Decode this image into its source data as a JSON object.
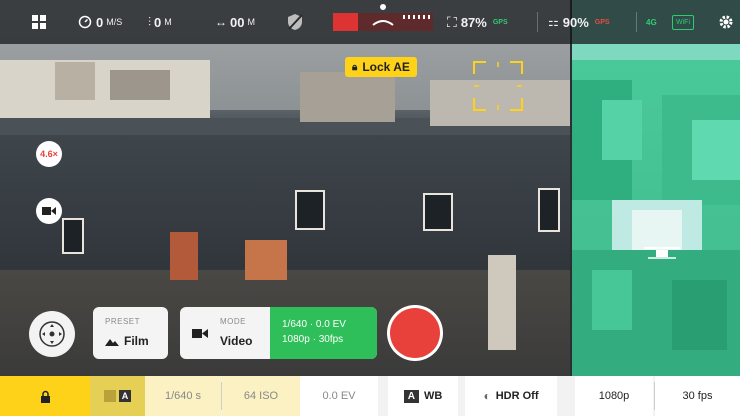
{
  "top_bar": {
    "speed": "0",
    "speed_unit": "M/S",
    "altitude": "0",
    "altitude_unit": "M",
    "distance": "00",
    "distance_unit": "M",
    "camera_battery": "87%",
    "gps_label": "GPS",
    "rc_battery": "90%",
    "rc_label": "GPS",
    "signal_label": "4G",
    "hd_label": "WiFi"
  },
  "lock_ae": {
    "label": "Lock AE"
  },
  "left_controls": {
    "ev_badge": "4.6×"
  },
  "preset": {
    "caption": "PRESET",
    "value": "Film"
  },
  "mode": {
    "caption": "MODE",
    "value": "Video",
    "info_line1": "1/640 · 0.0 EV",
    "info_line2": "1080p · 30fps"
  },
  "status_bar": {
    "shutter": "1/640 s",
    "iso": "64 ISO",
    "ev": "0.0 EV",
    "wb_badge": "A",
    "wb": "WB",
    "hdr": "HDR Off",
    "resolution": "1080p",
    "framerate": "30 fps",
    "auto_badge": "A"
  },
  "colors": {
    "accent_yellow": "#ffd21a",
    "record_red": "#e8413b",
    "info_green": "#2fbf5a",
    "teal_bg": "#7fd8c0"
  }
}
